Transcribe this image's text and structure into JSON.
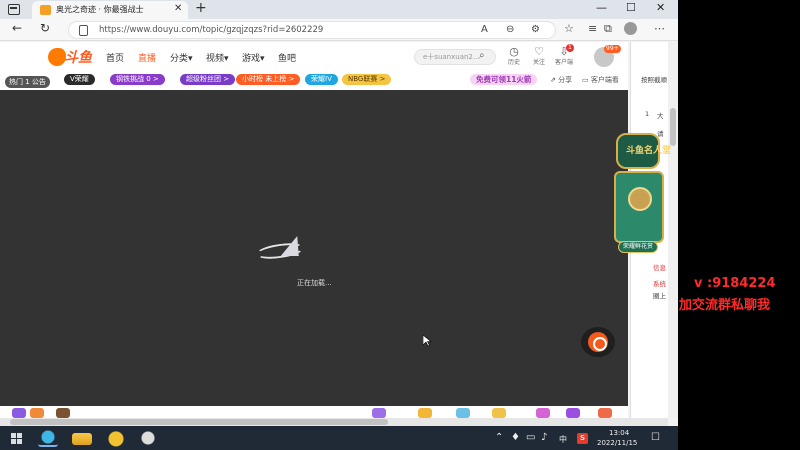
{
  "browser": {
    "tab_title": "奥光之奇迹 · 你最强战士",
    "new_tab": "+",
    "tab_close": "✕",
    "url": "https://www.douyu.com/topic/gzqjzqzs?rid=2602229",
    "controls": {
      "minimize": "—",
      "maximize": "☐",
      "close": "✕"
    },
    "nav": {
      "back": "←",
      "refresh": "↻"
    }
  },
  "site": {
    "logo_text": "斗鱼",
    "nav": [
      "首页",
      "直播",
      "分类",
      "视频",
      "游戏",
      "鱼吧"
    ],
    "search_placeholder": "e十suanxuan2...",
    "tools": [
      {
        "icon": "clock-icon",
        "label": "历史"
      },
      {
        "icon": "heart-icon",
        "label": "关注"
      },
      {
        "icon": "download-icon",
        "label": "客户端"
      }
    ],
    "client_badge": "1",
    "avatar_badge": "99+"
  },
  "roombar": {
    "hot": "热门  1  公告",
    "pills": [
      {
        "text": "V荣耀",
        "color": "#2b2b2b"
      },
      {
        "text": "钢铁挑战  0  >",
        "color": "#8a3cc8"
      },
      {
        "text": "超级粉丝团 >",
        "color": "#7a3cc8"
      },
      {
        "text": "小时榜  未上榜 >",
        "color": "#ff5d23"
      },
      {
        "text": "荣耀IV",
        "color": "#1ea7e1"
      },
      {
        "text": "NBG联赛 >",
        "color": "#f4c542"
      }
    ],
    "free_gift": "免费可领11火箭",
    "share": "分享",
    "client_watch": "客户端看"
  },
  "player": {
    "loading_text": "正在加载..."
  },
  "right_panel": {
    "items": [
      "按照截顺",
      "1",
      "大",
      "请",
      "信息",
      "系统",
      "圈上"
    ]
  },
  "promo": {
    "title": "斗鱼名人堂",
    "button": "荣耀鲜花赏"
  },
  "taskbar": {
    "time": "13:04",
    "date": "2022/11/15",
    "ime": "中",
    "ime2": "S",
    "notify": "☐"
  },
  "overlay": {
    "line1": "v  :9184224",
    "line2": "加交流群私聊我"
  }
}
